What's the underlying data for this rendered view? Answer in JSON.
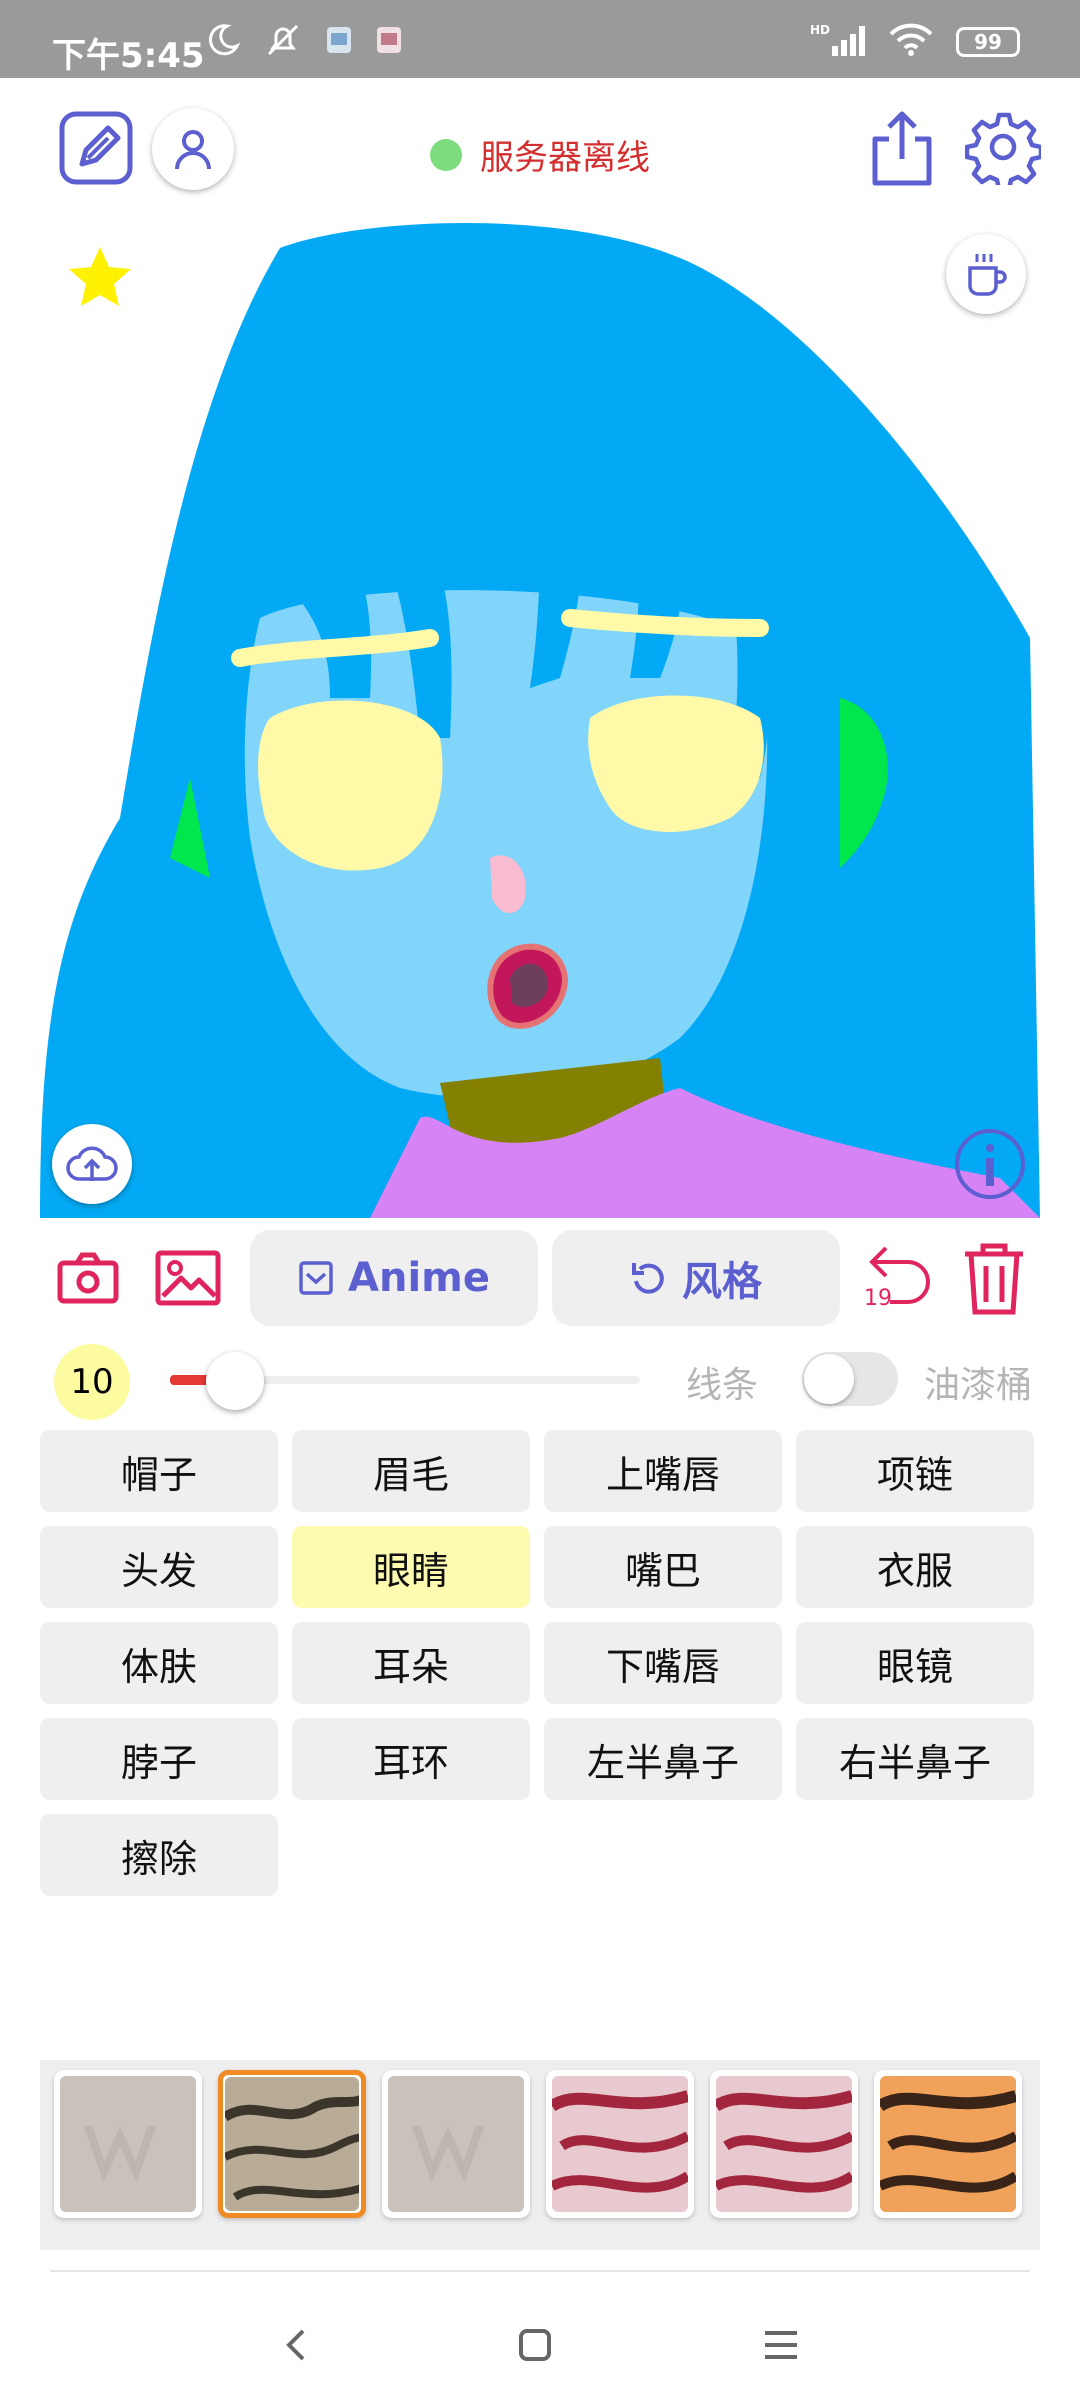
{
  "status_bar": {
    "time": "下午5:45",
    "battery": "99"
  },
  "header": {
    "server_status": "服务器离线"
  },
  "toolbar": {
    "anime_label": "Anime",
    "style_label": "风格",
    "undo_count": "19"
  },
  "brush": {
    "size": "10",
    "lines_label": "线条",
    "paint_bucket_label": "油漆桶"
  },
  "parts": [
    {
      "label": "帽子"
    },
    {
      "label": "眉毛"
    },
    {
      "label": "上嘴唇"
    },
    {
      "label": "项链"
    },
    {
      "label": "头发"
    },
    {
      "label": "眼睛"
    },
    {
      "label": "嘴巴"
    },
    {
      "label": "衣服"
    },
    {
      "label": "体肤"
    },
    {
      "label": "耳朵"
    },
    {
      "label": "下嘴唇"
    },
    {
      "label": "眼镜"
    },
    {
      "label": "脖子"
    },
    {
      "label": "耳环"
    },
    {
      "label": "左半鼻子"
    },
    {
      "label": "右半鼻子"
    },
    {
      "label": "擦除"
    }
  ],
  "selected_part": "眼睛",
  "colors": {
    "accent": "#5b5fd0",
    "danger": "#e0245e",
    "hair": "#03a9f4",
    "skin": "#81d4fa",
    "eyes": "#fff9a8",
    "clothes": "#d683f5",
    "neck": "#858100",
    "ears": "#00e64d"
  }
}
